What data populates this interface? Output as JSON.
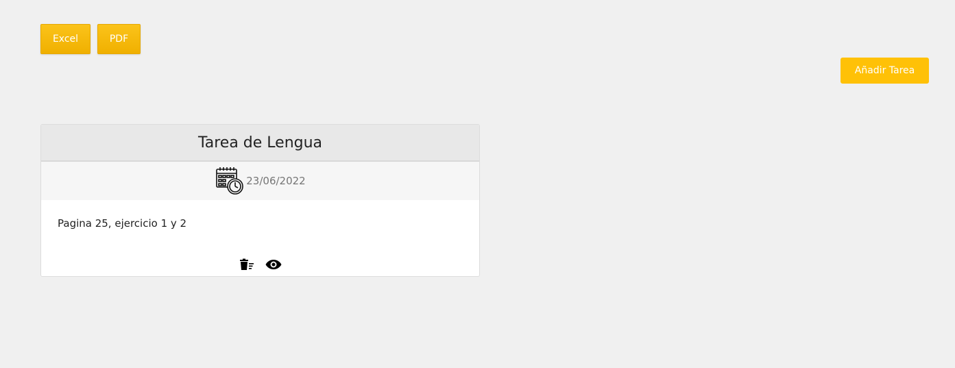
{
  "toolbar": {
    "excel_label": "Excel",
    "pdf_label": "PDF",
    "add_task_label": "Añadir Tarea"
  },
  "task": {
    "title": "Tarea de Lengua",
    "date": "23/06/2022",
    "description": "Pagina 25, ejercicio 1 y 2",
    "icons": {
      "date": "calendar-clock-icon",
      "delete": "trash-icon",
      "view": "eye-icon"
    }
  },
  "colors": {
    "accent": "#ffc107",
    "background": "#f0f0f0",
    "card_header": "#e8e8e8"
  }
}
